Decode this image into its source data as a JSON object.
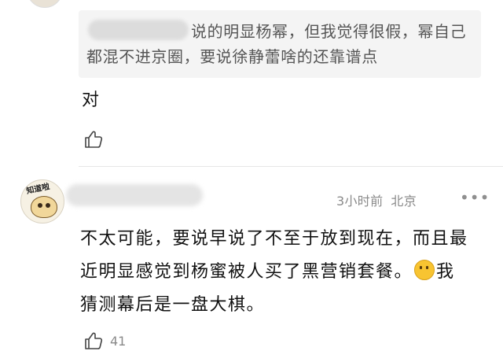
{
  "quote": {
    "text": "说的明显杨幂，但我觉得很假，幂自己都混不进京圈，要说徐静蕾啥的还靠谱点"
  },
  "reply": {
    "text": "对"
  },
  "comment": {
    "time": "3小时前",
    "location": "北京",
    "more": "•••",
    "text_part1": "不太可能，要说早说了不至于放到现在，而且最近明显感觉到杨蜜被人买了黑营销套餐。",
    "text_part2": "我猜测幕后是一盘大棋。",
    "likes": "41",
    "avatar_tag": "知道啦"
  }
}
